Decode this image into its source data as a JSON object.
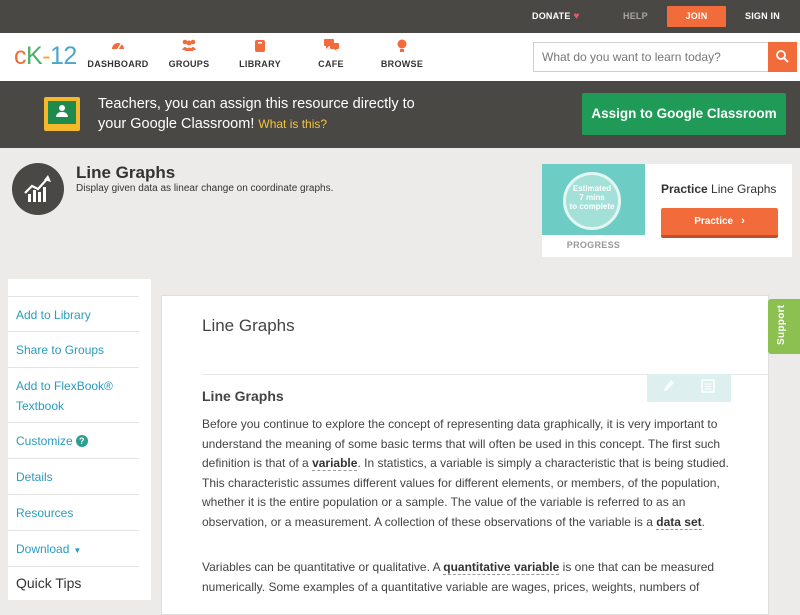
{
  "topbar": {
    "donate": "DONATE",
    "help": "HELP",
    "join": "JOIN",
    "signin": "SIGN IN"
  },
  "logo": {
    "c": "c",
    "k": "K",
    "dash": "-",
    "num": "12"
  },
  "nav": {
    "items": [
      {
        "label": "DASHBOARD",
        "icon": "dashboard-icon"
      },
      {
        "label": "GROUPS",
        "icon": "groups-icon"
      },
      {
        "label": "LIBRARY",
        "icon": "library-icon"
      },
      {
        "label": "CAFE",
        "icon": "cafe-icon"
      },
      {
        "label": "BROWSE",
        "icon": "browse-icon"
      }
    ],
    "search_placeholder": "What do you want to learn today?"
  },
  "banner": {
    "text": "Teachers, you can assign this resource directly to your Google Classroom!",
    "link": "What is this?",
    "button": "Assign to Google Classroom"
  },
  "concept": {
    "title": "Line Graphs",
    "subtitle": "Display given data as linear change on coordinate graphs."
  },
  "practice": {
    "circle_line1": "Estimated",
    "circle_line2": "7 mins",
    "circle_line3": "to complete",
    "progress_label": "PROGRESS",
    "title_bold": "Practice",
    "title_rest": " Line Graphs",
    "button": "Practice"
  },
  "sidebar": {
    "items": [
      {
        "label": "Add to Library"
      },
      {
        "label": "Share to Groups"
      },
      {
        "label": "Add to FlexBook® Textbook"
      },
      {
        "label": "Customize"
      },
      {
        "label": "Details"
      },
      {
        "label": "Resources"
      },
      {
        "label": "Download"
      }
    ],
    "quick_tips": "Quick Tips"
  },
  "main": {
    "title": "Line Graphs",
    "section_title": "Line Graphs",
    "p1_a": "Before you continue to explore the concept of representing data graphically, it is very important to understand the meaning of some basic terms that will often be used in this concept. The first such definition is that of a ",
    "p1_term1": "variable",
    "p1_b": ". In statistics, a variable is simply a characteristic that is being studied. This characteristic assumes different values for different elements, or members, of the population, whether it is the entire population or a sample. The value of the variable is referred to as an observation, or a measurement. A collection of these observations of the variable is a ",
    "p1_term2": "data set",
    "p1_c": ".",
    "p2_a": "Variables can be quantitative or qualitative. A ",
    "p2_term": "quantitative variable",
    "p2_b": " is one that can be measured numerically. Some examples of a quantitative variable are wages, prices, weights, numbers of"
  },
  "support": "Support",
  "colors": {
    "accent": "#f26b3a",
    "dark": "#4a4845",
    "green": "#1f9b57",
    "link": "#2a9abf"
  }
}
